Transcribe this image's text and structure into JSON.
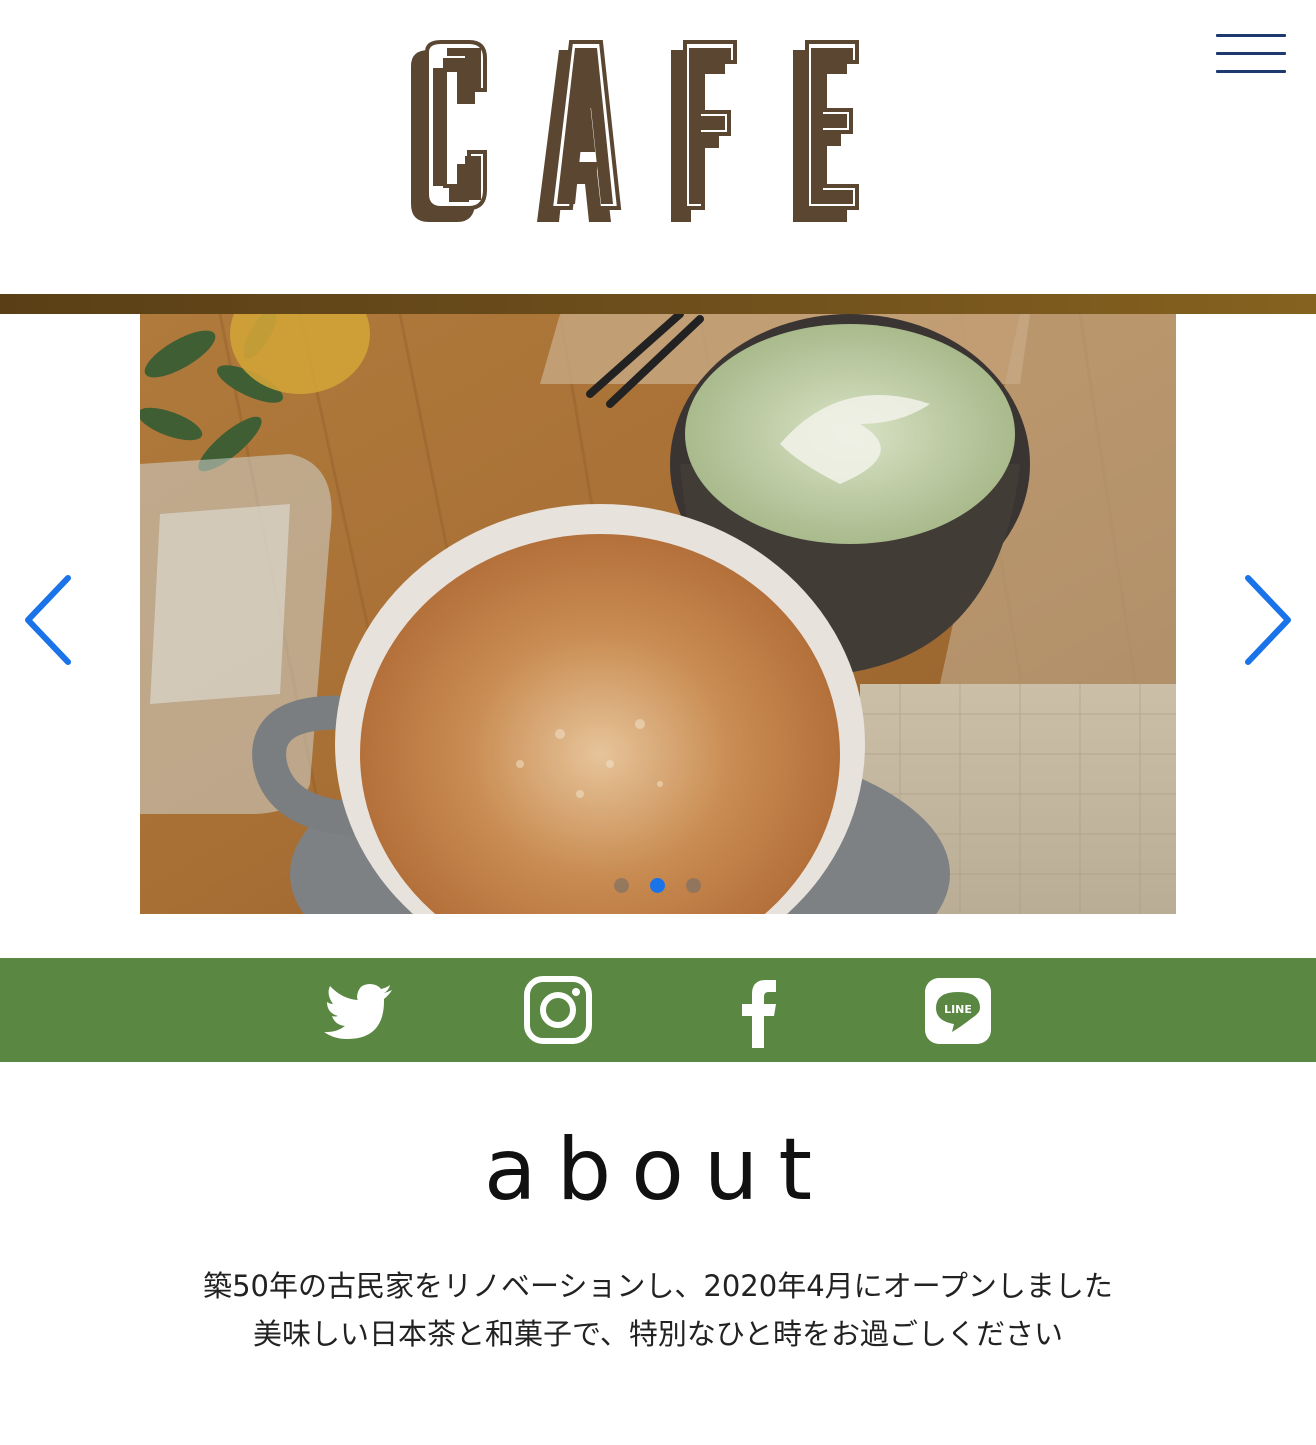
{
  "header": {
    "logo_text": "CAFE",
    "menu_icon": "hamburger-icon",
    "menu_color": "#1c3a6e",
    "logo_color": "#5b4632"
  },
  "banner": {
    "band_colors": [
      "#5a3f16",
      "#86621f"
    ]
  },
  "slider": {
    "prev_icon": "chevron-left-icon",
    "next_icon": "chevron-right-icon",
    "arrow_color": "#1a73e8",
    "slide_count": 3,
    "active_slide": 2
  },
  "social": {
    "background": "#5a8742",
    "items": [
      {
        "name": "twitter",
        "icon": "twitter-icon"
      },
      {
        "name": "instagram",
        "icon": "instagram-icon"
      },
      {
        "name": "facebook",
        "icon": "facebook-icon"
      },
      {
        "name": "line",
        "icon": "line-icon",
        "label": "LINE"
      }
    ]
  },
  "about": {
    "title": "about",
    "lines": [
      "築50年の古民家をリノベーションし、2020年4月にオープンしました",
      "美味しい日本茶と和菓子で、特別なひと時をお過ごしください"
    ]
  }
}
